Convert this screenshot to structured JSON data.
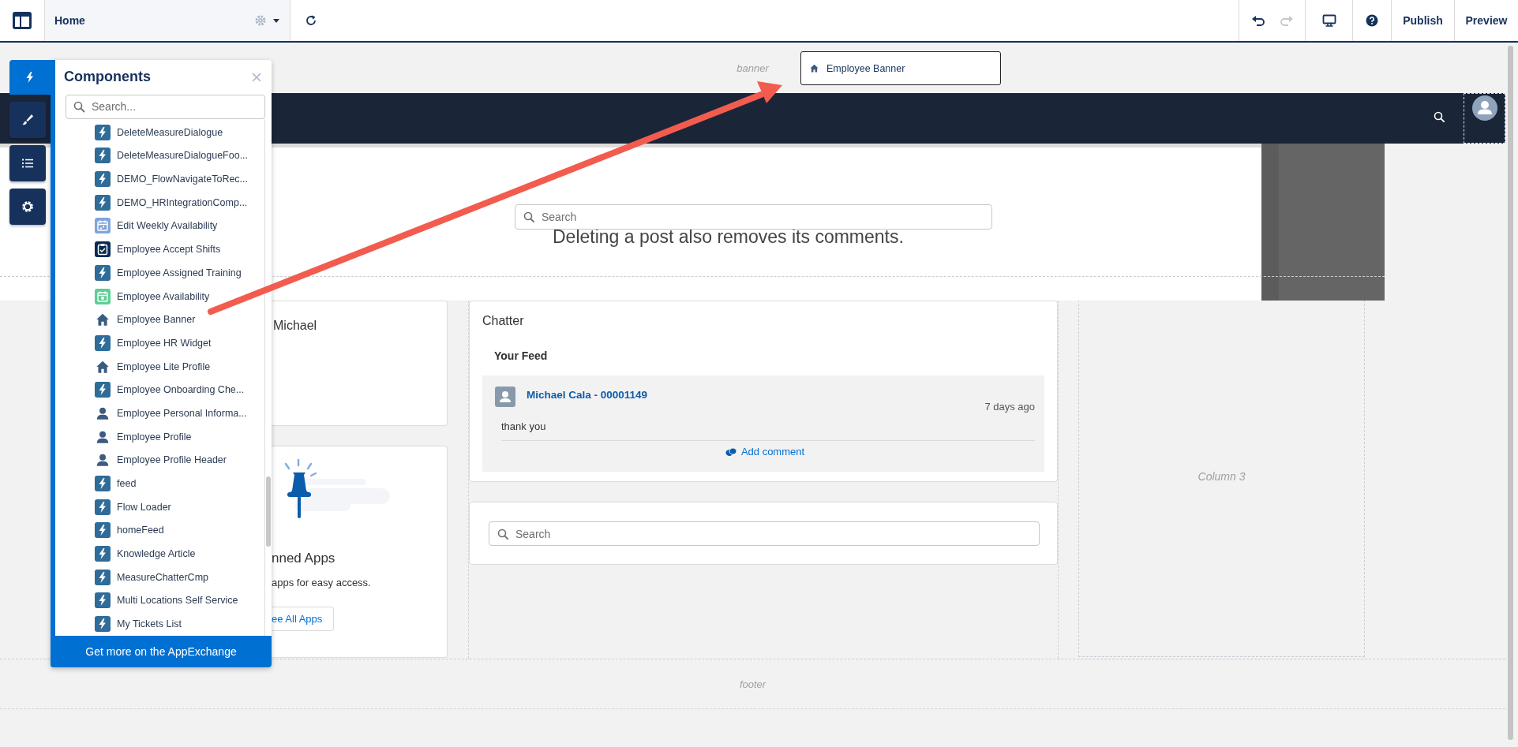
{
  "toolbar": {
    "page_tab": {
      "label": "Home"
    },
    "history": [
      {
        "kind": "undo",
        "disabled": false
      },
      {
        "kind": "redo",
        "disabled": true
      }
    ],
    "buttons": [
      "Publish",
      "Preview"
    ]
  },
  "side_tabs": [
    {
      "kind": "lightning",
      "selected": true
    },
    {
      "kind": "brush",
      "selected": false
    },
    {
      "kind": "list",
      "selected": false
    },
    {
      "kind": "gear",
      "selected": false
    }
  ],
  "components_panel": {
    "title": "Components",
    "search": {
      "placeholder": "Search..."
    },
    "items": [
      {
        "label": "DeleteMeasureDialogue",
        "kind": "lightning"
      },
      {
        "label": "DeleteMeasureDialogueFoo...",
        "kind": "lightning"
      },
      {
        "label": "DEMO_FlowNavigateToRec...",
        "kind": "lightning"
      },
      {
        "label": "DEMO_HRIntegrationComp...",
        "kind": "lightning"
      },
      {
        "label": "Edit Weekly Availability",
        "kind": "calendar"
      },
      {
        "label": "Employee Accept Shifts",
        "kind": "clipboard"
      },
      {
        "label": "Employee Assigned Training",
        "kind": "lightning"
      },
      {
        "label": "Employee Availability",
        "kind": "calendar-check"
      },
      {
        "label": "Employee Banner",
        "kind": "home"
      },
      {
        "label": "Employee HR Widget",
        "kind": "lightning"
      },
      {
        "label": "Employee Lite Profile",
        "kind": "home"
      },
      {
        "label": "Employee Onboarding Che...",
        "kind": "lightning"
      },
      {
        "label": "Employee Personal Informa...",
        "kind": "person"
      },
      {
        "label": "Employee Profile",
        "kind": "person"
      },
      {
        "label": "Employee Profile Header",
        "kind": "person"
      },
      {
        "label": "feed",
        "kind": "lightning"
      },
      {
        "label": "Flow Loader",
        "kind": "lightning"
      },
      {
        "label": "homeFeed",
        "kind": "lightning"
      },
      {
        "label": "Knowledge Article",
        "kind": "lightning"
      },
      {
        "label": "MeasureChatterCmp",
        "kind": "lightning"
      },
      {
        "label": "Multi Locations Self Service",
        "kind": "lightning"
      },
      {
        "label": "My Tickets List",
        "kind": "lightning"
      }
    ],
    "footer_button": "Get more on the AppExchange"
  },
  "canvas": {
    "banner_region": "banner",
    "drag_preview": {
      "label": "Employee Banner"
    },
    "hero": {
      "search": {
        "placeholder": "Search"
      },
      "message": "Deleting a post also removes its comments."
    },
    "column_1": {
      "greeting": "Michael",
      "pinned": {
        "title": "nned Apps",
        "text": "apps for easy access.",
        "button": "ee All Apps"
      }
    },
    "chatter": {
      "title": "Chatter",
      "feed_title": "Your Feed",
      "post": {
        "author": "Michael Cala - 00001149",
        "time": "7 days ago",
        "body": "thank you",
        "action": "Add comment"
      }
    },
    "search_card": {
      "placeholder": "Search"
    },
    "column_3": "Column 3",
    "footer_region": "footer"
  }
}
